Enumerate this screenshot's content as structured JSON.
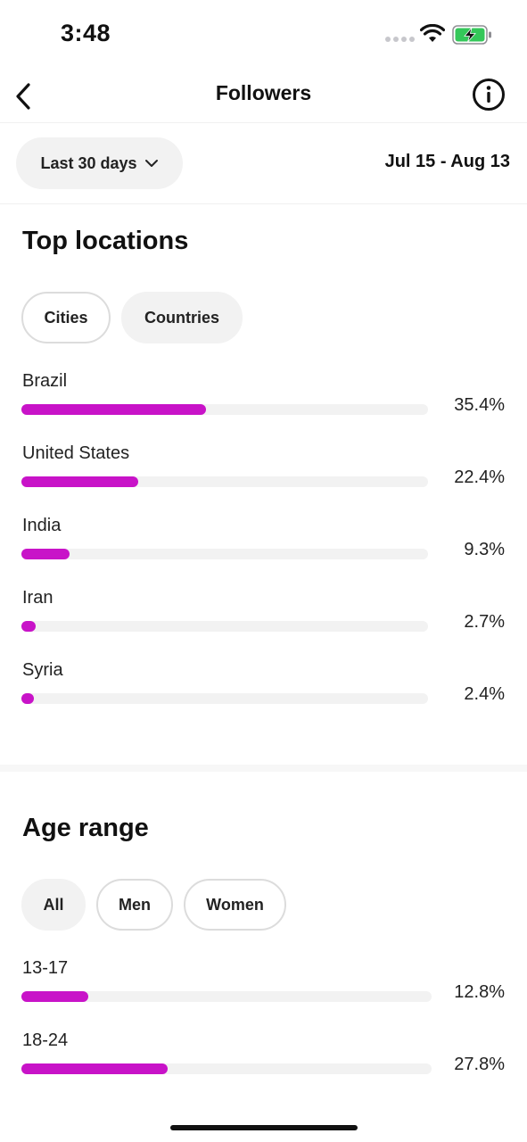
{
  "status_bar": {
    "time": "3:48",
    "wifi_icon": "wifi-icon",
    "battery_icon": "battery-charging-icon"
  },
  "header": {
    "title": "Followers",
    "back_icon": "chevron-left-icon",
    "info_icon": "info-icon"
  },
  "date_filter": {
    "range_label": "Last 30 days",
    "dates": "Jul 15 - Aug 13"
  },
  "accent_color": "#c813c8",
  "top_locations": {
    "title": "Top locations",
    "tabs": [
      {
        "label": "Cities",
        "selected": false
      },
      {
        "label": "Countries",
        "selected": true
      }
    ],
    "items": [
      {
        "label": "Brazil",
        "value": "35.4%",
        "pct": 35.4
      },
      {
        "label": "United States",
        "value": "22.4%",
        "pct": 22.4
      },
      {
        "label": "India",
        "value": "9.3%",
        "pct": 9.3
      },
      {
        "label": "Iran",
        "value": "2.7%",
        "pct": 2.7
      },
      {
        "label": "Syria",
        "value": "2.4%",
        "pct": 2.4
      }
    ]
  },
  "age_range": {
    "title": "Age range",
    "tabs": [
      {
        "label": "All",
        "selected": true
      },
      {
        "label": "Men",
        "selected": false
      },
      {
        "label": "Women",
        "selected": false
      }
    ],
    "items": [
      {
        "label": "13-17",
        "value": "12.8%",
        "pct": 12.8
      },
      {
        "label": "18-24",
        "value": "27.8%",
        "pct": 27.8
      }
    ]
  }
}
